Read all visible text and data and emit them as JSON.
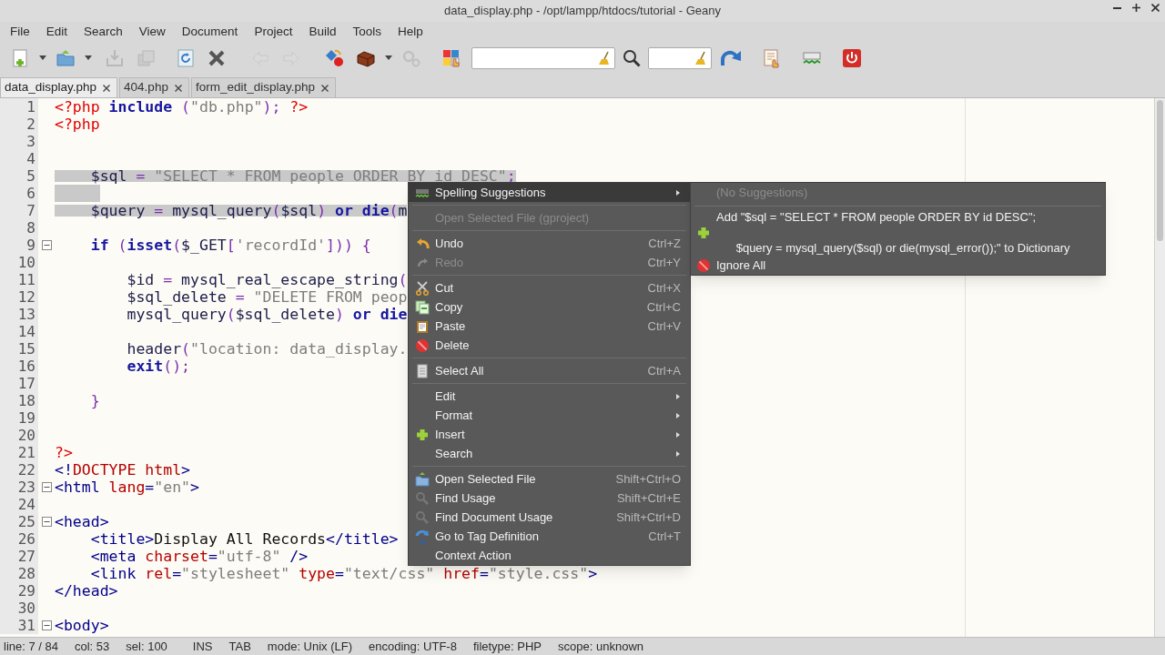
{
  "window": {
    "title": "data_display.php - /opt/lampp/htdocs/tutorial - Geany"
  },
  "menu_bar": [
    "File",
    "Edit",
    "Search",
    "View",
    "Document",
    "Project",
    "Build",
    "Tools",
    "Help"
  ],
  "toolbar": [
    {
      "kind": "button",
      "disabled": false
    },
    {
      "kind": "dropdown",
      "disabled": false
    },
    {
      "kind": "button",
      "disabled": false
    },
    {
      "kind": "dropdown",
      "disabled": false
    },
    {
      "kind": "button",
      "disabled": true
    },
    {
      "kind": "button",
      "disabled": true
    },
    {
      "kind": "button",
      "disabled": false
    },
    {
      "kind": "button",
      "disabled": false
    },
    {
      "kind": "button",
      "disabled": true
    },
    {
      "kind": "button",
      "disabled": true
    },
    {
      "kind": "button",
      "disabled": false
    },
    {
      "kind": "button",
      "disabled": false
    },
    {
      "kind": "dropdown",
      "disabled": false
    },
    {
      "kind": "button",
      "disabled": true
    },
    {
      "kind": "button",
      "disabled": false
    },
    {
      "kind": "field",
      "disabled": false
    },
    {
      "kind": "button",
      "disabled": false
    },
    {
      "kind": "field",
      "disabled": false
    },
    {
      "kind": "button",
      "disabled": false
    },
    {
      "kind": "button",
      "disabled": false
    },
    {
      "kind": "button",
      "disabled": false
    },
    {
      "kind": "button",
      "disabled": false
    }
  ],
  "tabs": [
    {
      "label": "data_display.php",
      "selected": true
    },
    {
      "label": "404.php",
      "selected": false
    },
    {
      "label": "form_edit_display.php",
      "selected": false
    }
  ],
  "editor": {
    "lines": [
      {
        "number": "1",
        "selected": false,
        "fold": false,
        "tokens": [
          {
            "kind": "phptag",
            "text": "<?php "
          },
          {
            "kind": "keyword",
            "text": "include"
          },
          {
            "kind": "op",
            "text": " ("
          },
          {
            "kind": "string",
            "text": "\"db.php\""
          },
          {
            "kind": "op",
            "text": "); "
          },
          {
            "kind": "phptag",
            "text": "?>"
          }
        ]
      },
      {
        "number": "2",
        "selected": false,
        "fold": false,
        "tokens": [
          {
            "kind": "phptag",
            "text": "<?php"
          }
        ]
      },
      {
        "number": "3",
        "selected": false,
        "fold": false
      },
      {
        "number": "4",
        "selected": false,
        "fold": false
      },
      {
        "number": "5",
        "selected": true,
        "fold": false,
        "tokens": [
          {
            "kind": "var",
            "text": "    $sql "
          },
          {
            "kind": "op",
            "text": "= "
          },
          {
            "kind": "string",
            "text": "\"SELECT * FROM people ORDER BY id DESC\""
          },
          {
            "kind": "op",
            "text": ";"
          }
        ]
      },
      {
        "number": "6",
        "selected": true,
        "fold": false
      },
      {
        "number": "7",
        "selected": true,
        "fold": false,
        "tokens": [
          {
            "kind": "var",
            "text": "    $query "
          },
          {
            "kind": "op",
            "text": "= "
          },
          {
            "kind": "plain",
            "text": "mysql_query"
          },
          {
            "kind": "op",
            "text": "("
          },
          {
            "kind": "var",
            "text": "$sql"
          },
          {
            "kind": "op",
            "text": ") "
          },
          {
            "kind": "keyword",
            "text": "or die"
          },
          {
            "kind": "op",
            "text": "("
          },
          {
            "kind": "plain",
            "text": "m"
          }
        ]
      },
      {
        "number": "8",
        "selected": false,
        "fold": false
      },
      {
        "number": "9",
        "selected": false,
        "fold": true,
        "tokens": [
          {
            "kind": "keyword",
            "text": "    if "
          },
          {
            "kind": "op",
            "text": "("
          },
          {
            "kind": "keyword",
            "text": "isset"
          },
          {
            "kind": "op",
            "text": "("
          },
          {
            "kind": "var",
            "text": "$_GET"
          },
          {
            "kind": "op",
            "text": "["
          },
          {
            "kind": "string",
            "text": "'recordId'"
          },
          {
            "kind": "op",
            "text": "])) {"
          }
        ]
      },
      {
        "number": "10",
        "selected": false,
        "fold": false
      },
      {
        "number": "11",
        "selected": false,
        "fold": false,
        "tokens": [
          {
            "kind": "var",
            "text": "        $id "
          },
          {
            "kind": "op",
            "text": "= "
          },
          {
            "kind": "plain",
            "text": "mysql_real_escape_string"
          },
          {
            "kind": "op",
            "text": "("
          }
        ]
      },
      {
        "number": "12",
        "selected": false,
        "fold": false,
        "tokens": [
          {
            "kind": "var",
            "text": "        $sql_delete "
          },
          {
            "kind": "op",
            "text": "= "
          },
          {
            "kind": "string",
            "text": "\"DELETE FROM peop"
          }
        ]
      },
      {
        "number": "13",
        "selected": false,
        "fold": false,
        "tokens": [
          {
            "kind": "plain",
            "text": "        mysql_query"
          },
          {
            "kind": "op",
            "text": "("
          },
          {
            "kind": "var",
            "text": "$sql_delete"
          },
          {
            "kind": "op",
            "text": ") "
          },
          {
            "kind": "keyword",
            "text": "or die"
          }
        ]
      },
      {
        "number": "14",
        "selected": false,
        "fold": false
      },
      {
        "number": "15",
        "selected": false,
        "fold": false,
        "tokens": [
          {
            "kind": "plain",
            "text": "        header"
          },
          {
            "kind": "op",
            "text": "("
          },
          {
            "kind": "string",
            "text": "\"location: data_display."
          }
        ]
      },
      {
        "number": "16",
        "selected": false,
        "fold": false,
        "tokens": [
          {
            "kind": "keyword",
            "text": "        exit"
          },
          {
            "kind": "op",
            "text": "();"
          }
        ]
      },
      {
        "number": "17",
        "selected": false,
        "fold": false
      },
      {
        "number": "18",
        "selected": false,
        "fold": false,
        "tokens": [
          {
            "kind": "op",
            "text": "    }"
          }
        ]
      },
      {
        "number": "19",
        "selected": false,
        "fold": false
      },
      {
        "number": "20",
        "selected": false,
        "fold": false
      },
      {
        "number": "21",
        "selected": false,
        "fold": false,
        "tokens": [
          {
            "kind": "phptag",
            "text": "?>"
          }
        ]
      },
      {
        "number": "22",
        "selected": false,
        "fold": false,
        "tokens": [
          {
            "kind": "tag",
            "text": "<!"
          },
          {
            "kind": "attr",
            "text": "DOCTYPE html"
          },
          {
            "kind": "tag",
            "text": ">"
          }
        ]
      },
      {
        "number": "23",
        "selected": false,
        "fold": true,
        "tokens": [
          {
            "kind": "tag",
            "text": "<html "
          },
          {
            "kind": "attr",
            "text": "lang"
          },
          {
            "kind": "tag",
            "text": "="
          },
          {
            "kind": "string",
            "text": "\"en\""
          },
          {
            "kind": "tag",
            "text": ">"
          }
        ]
      },
      {
        "number": "24",
        "selected": false,
        "fold": false
      },
      {
        "number": "25",
        "selected": false,
        "fold": true,
        "tokens": [
          {
            "kind": "tag",
            "text": "<head>"
          }
        ]
      },
      {
        "number": "26",
        "selected": false,
        "fold": false,
        "tokens": [
          {
            "kind": "tag",
            "text": "    <title>"
          },
          {
            "kind": "text",
            "text": "Display All Records"
          },
          {
            "kind": "tag",
            "text": "</title>"
          }
        ]
      },
      {
        "number": "27",
        "selected": false,
        "fold": false,
        "tokens": [
          {
            "kind": "tag",
            "text": "    <meta "
          },
          {
            "kind": "attr",
            "text": "charset"
          },
          {
            "kind": "tag",
            "text": "="
          },
          {
            "kind": "string",
            "text": "\"utf-8\""
          },
          {
            "kind": "tag",
            "text": " />"
          }
        ]
      },
      {
        "number": "28",
        "selected": false,
        "fold": false,
        "tokens": [
          {
            "kind": "tag",
            "text": "    <link "
          },
          {
            "kind": "attr",
            "text": "rel"
          },
          {
            "kind": "tag",
            "text": "="
          },
          {
            "kind": "string",
            "text": "\"stylesheet\" "
          },
          {
            "kind": "attr",
            "text": "type"
          },
          {
            "kind": "tag",
            "text": "="
          },
          {
            "kind": "string",
            "text": "\"text/css\" "
          },
          {
            "kind": "attr",
            "text": "href"
          },
          {
            "kind": "tag",
            "text": "="
          },
          {
            "kind": "string",
            "text": "\"style.css\""
          },
          {
            "kind": "tag",
            "text": ">"
          }
        ]
      },
      {
        "number": "29",
        "selected": false,
        "fold": false,
        "tokens": [
          {
            "kind": "tag",
            "text": "</head>"
          }
        ]
      },
      {
        "number": "30",
        "selected": false,
        "fold": false
      },
      {
        "number": "31",
        "selected": false,
        "fold": true,
        "tokens": [
          {
            "kind": "tag",
            "text": "<body>"
          }
        ]
      }
    ]
  },
  "context_menu": {
    "sections": [
      [
        {
          "label": "Spelling Suggestions",
          "selected": true,
          "disabled": false,
          "submenu": true
        }
      ],
      [
        {
          "label": "Open Selected File (gproject)",
          "selected": false,
          "disabled": true,
          "submenu": false
        }
      ],
      [
        {
          "label": "Undo",
          "shortcut": "Ctrl+Z",
          "selected": false,
          "disabled": false,
          "submenu": false
        },
        {
          "label": "Redo",
          "shortcut": "Ctrl+Y",
          "selected": false,
          "disabled": true,
          "submenu": false
        }
      ],
      [
        {
          "label": "Cut",
          "shortcut": "Ctrl+X",
          "selected": false,
          "disabled": false,
          "submenu": false
        },
        {
          "label": "Copy",
          "shortcut": "Ctrl+C",
          "selected": false,
          "disabled": false,
          "submenu": false
        },
        {
          "label": "Paste",
          "shortcut": "Ctrl+V",
          "selected": false,
          "disabled": false,
          "submenu": false
        },
        {
          "label": "Delete",
          "selected": false,
          "disabled": false,
          "submenu": false
        }
      ],
      [
        {
          "label": "Select All",
          "shortcut": "Ctrl+A",
          "selected": false,
          "disabled": false,
          "submenu": false
        }
      ],
      [
        {
          "label": "Edit",
          "selected": false,
          "disabled": false,
          "submenu": true
        },
        {
          "label": "Format",
          "selected": false,
          "disabled": false,
          "submenu": true
        },
        {
          "label": "Insert",
          "selected": false,
          "disabled": false,
          "submenu": true
        },
        {
          "label": "Search",
          "selected": false,
          "disabled": false,
          "submenu": true
        }
      ],
      [
        {
          "label": "Open Selected File",
          "shortcut": "Shift+Ctrl+O",
          "selected": false,
          "disabled": false,
          "submenu": false
        },
        {
          "label": "Find Usage",
          "shortcut": "Shift+Ctrl+E",
          "selected": false,
          "disabled": false,
          "submenu": false
        },
        {
          "label": "Find Document Usage",
          "shortcut": "Shift+Ctrl+D",
          "selected": false,
          "disabled": false,
          "submenu": false
        },
        {
          "label": "Go to Tag Definition",
          "shortcut": "Ctrl+T",
          "selected": false,
          "disabled": false,
          "submenu": false
        },
        {
          "label": "Context Action",
          "selected": false,
          "disabled": false,
          "submenu": false
        }
      ]
    ]
  },
  "spelling_submenu": {
    "sections": [
      [
        {
          "label": "(No Suggestions)",
          "disabled": true
        }
      ],
      [
        {
          "label": "Add \"$sql = \"SELECT * FROM people ORDER BY id DESC\";\n\n      $query = mysql_query($sql) or die(mysql_error());\" to Dictionary",
          "disabled": false
        },
        {
          "label": "Ignore All",
          "disabled": false
        }
      ]
    ]
  },
  "status_bar": [
    "line: 7 / 84",
    "col: 53",
    "sel: 100",
    "INS",
    "TAB",
    "mode: Unix (LF)",
    "encoding: UTF-8",
    "filetype: PHP",
    "scope: unknown"
  ]
}
